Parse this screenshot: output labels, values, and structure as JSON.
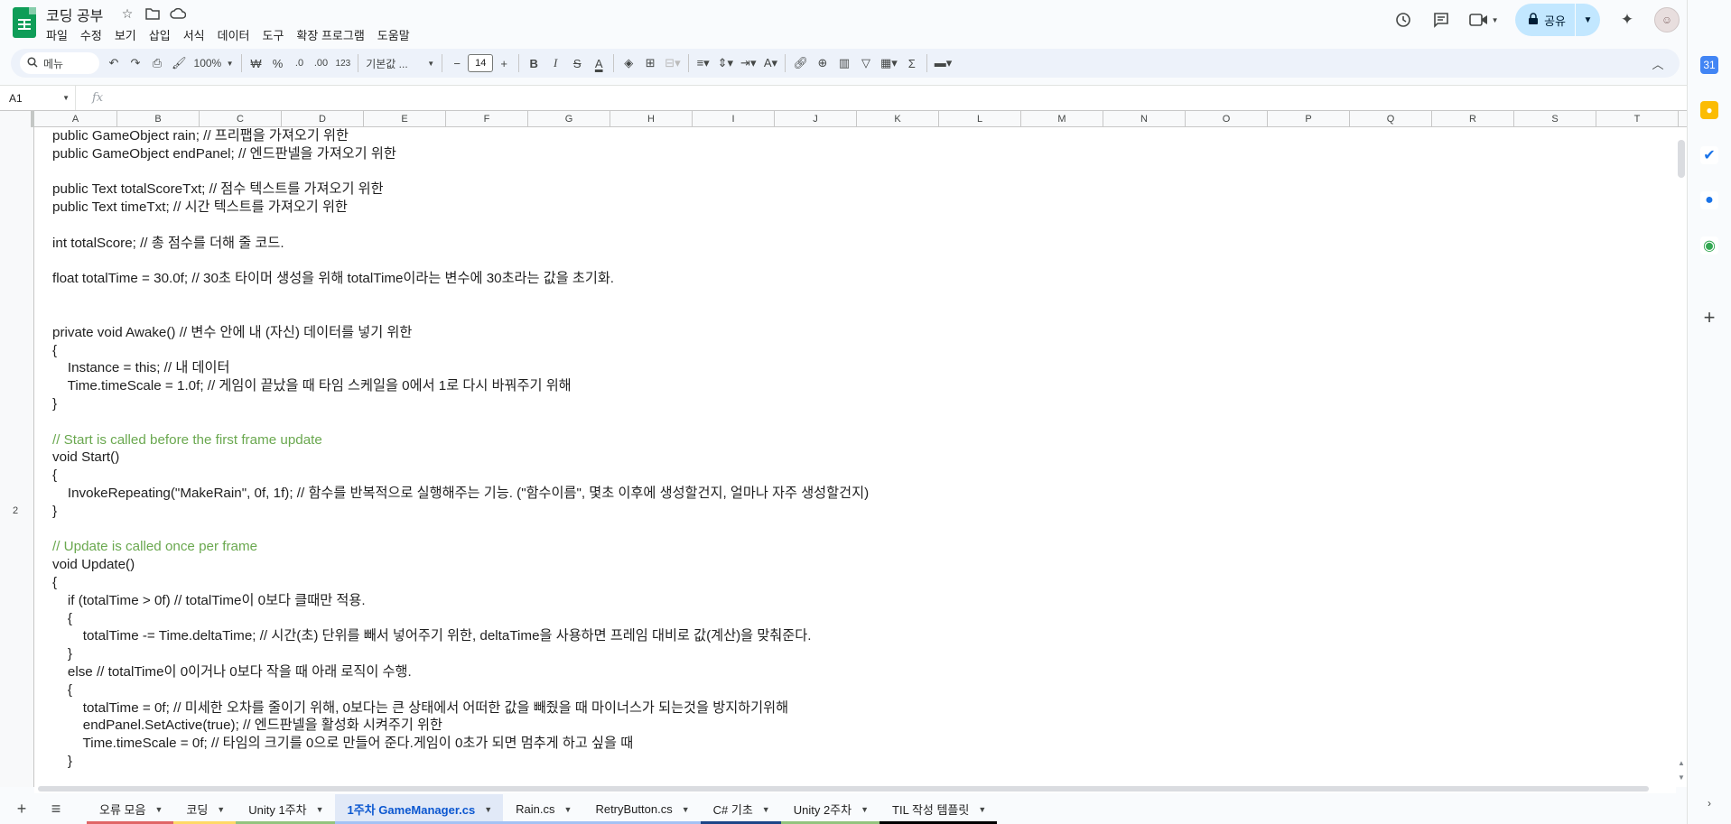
{
  "app": {
    "doc_title": "코딩 공부",
    "menu": [
      "파일",
      "수정",
      "보기",
      "삽입",
      "서식",
      "데이터",
      "도구",
      "확장 프로그램",
      "도움말"
    ],
    "share_label": "공유"
  },
  "toolbar": {
    "search_label": "메뉴",
    "zoom": "100%",
    "currency": "₩",
    "percent": "%",
    "dec_decrease": ".0",
    "dec_increase": ".00",
    "number_format": "123",
    "font": "기본값 ...",
    "font_size": "14",
    "minus": "−",
    "plus": "+",
    "bold": "B",
    "italic": "I",
    "strike": "S",
    "textcolor": "A"
  },
  "formula_bar": {
    "cell_ref": "A1",
    "fx": "fx"
  },
  "grid": {
    "columns": [
      "A",
      "B",
      "C",
      "D",
      "E",
      "F",
      "G",
      "H",
      "I",
      "J",
      "K",
      "L",
      "M",
      "N",
      "O",
      "P",
      "Q",
      "R",
      "S",
      "T"
    ],
    "row_label": "2",
    "code_lines": [
      {
        "text": "public GameObject rain; // 프리팹을 가져오기 위한",
        "comment": false
      },
      {
        "text": "public GameObject endPanel; // 엔드판넬을 가져오기 위한",
        "comment": false
      },
      {
        "text": "",
        "comment": false
      },
      {
        "text": "public Text totalScoreTxt; // 점수 텍스트를 가져오기 위한",
        "comment": false
      },
      {
        "text": "public Text timeTxt; // 시간 텍스트를 가져오기 위한",
        "comment": false
      },
      {
        "text": "",
        "comment": false
      },
      {
        "text": "int totalScore; // 총 점수를 더해 줄 코드.",
        "comment": false
      },
      {
        "text": "",
        "comment": false
      },
      {
        "text": "float totalTime = 30.0f; // 30초 타이머 생성을 위해 totalTime이라는 변수에 30초라는 값을 초기화.",
        "comment": false
      },
      {
        "text": "",
        "comment": false
      },
      {
        "text": "",
        "comment": false
      },
      {
        "text": "private void Awake() // 변수 안에 내 (자신) 데이터를 넣기 위한",
        "comment": false
      },
      {
        "text": "{",
        "comment": false
      },
      {
        "text": "    Instance = this; // 내 데이터",
        "comment": false
      },
      {
        "text": "    Time.timeScale = 1.0f; // 게임이 끝났을 때 타임 스케일을 0에서 1로 다시 바꿔주기 위해",
        "comment": false
      },
      {
        "text": "}",
        "comment": false
      },
      {
        "text": "",
        "comment": false
      },
      {
        "text": "// Start is called before the first frame update",
        "comment": true
      },
      {
        "text": "void Start()",
        "comment": false
      },
      {
        "text": "{",
        "comment": false
      },
      {
        "text": "    InvokeRepeating(\"MakeRain\", 0f, 1f); // 함수를 반복적으로 실행해주는 기능. (\"함수이름\", 몇초 이후에 생성할건지, 얼마나 자주 생성할건지)",
        "comment": false
      },
      {
        "text": "}",
        "comment": false
      },
      {
        "text": "",
        "comment": false
      },
      {
        "text": "// Update is called once per frame",
        "comment": true
      },
      {
        "text": "void Update()",
        "comment": false
      },
      {
        "text": "{",
        "comment": false
      },
      {
        "text": "    if (totalTime > 0f) // totalTime이 0보다 클때만 적용.",
        "comment": false
      },
      {
        "text": "    {",
        "comment": false
      },
      {
        "text": "        totalTime -= Time.deltaTime; // 시간(초) 단위를 빼서 넣어주기 위한, deltaTime을 사용하면 프레임 대비로 값(계산)을 맞춰준다.",
        "comment": false
      },
      {
        "text": "    }",
        "comment": false
      },
      {
        "text": "    else // totalTime이 0이거나 0보다 작을 때 아래 로직이 수행.",
        "comment": false
      },
      {
        "text": "    {",
        "comment": false
      },
      {
        "text": "        totalTime = 0f; // 미세한 오차를 줄이기 위해, 0보다는 큰 상태에서 어떠한 값을 빼줬을 때 마이너스가 되는것을 방지하기위해",
        "comment": false
      },
      {
        "text": "        endPanel.SetActive(true); // 엔드판넬을 활성화 시켜주기 위한",
        "comment": false
      },
      {
        "text": "        Time.timeScale = 0f; // 타임의 크기를 0으로 만들어 준다.게임이 0초가 되면 멈추게 하고 싶을 때",
        "comment": false
      },
      {
        "text": "    }",
        "comment": false
      }
    ]
  },
  "sheet_tabs": [
    {
      "label": "오류 모음",
      "color": "#e06666",
      "active": false
    },
    {
      "label": "코딩",
      "color": "#ffd966",
      "active": false
    },
    {
      "label": "Unity 1주차",
      "color": "#93c47d",
      "active": false
    },
    {
      "label": "1주차 GameManager.cs",
      "color": "#a4c2f4",
      "active": true
    },
    {
      "label": "Rain.cs",
      "color": "#a4c2f4",
      "active": false
    },
    {
      "label": "RetryButton.cs",
      "color": "#a4c2f4",
      "active": false
    },
    {
      "label": "C# 기초",
      "color": "#1c4587",
      "active": false
    },
    {
      "label": "Unity 2주차",
      "color": "#93c47d",
      "active": false
    },
    {
      "label": "TIL 작성 템플릿",
      "color": "#000000",
      "active": false
    }
  ],
  "colors": {
    "accent": "#0b57d0",
    "comment": "#6aa84f",
    "sheets_green": "#0f9d58",
    "share_bg": "#c2e7ff"
  }
}
